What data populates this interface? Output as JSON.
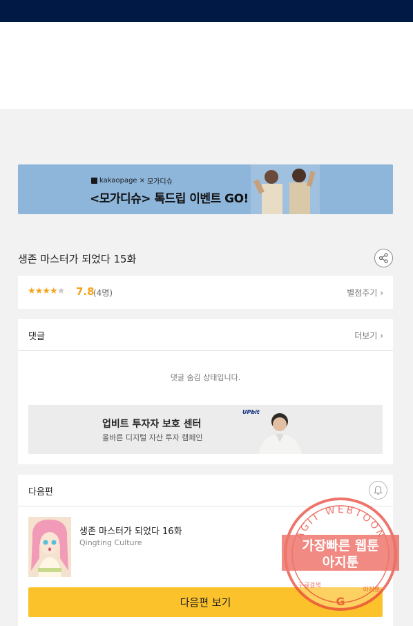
{
  "banner": {
    "brand_kakao": "kakaopage",
    "brand_sep": "×",
    "brand_partner": "모가디슈",
    "headline": "<모가디슈> 톡드립 이벤트 GO!"
  },
  "episode": {
    "title": "생존 마스터가 되었다 15화"
  },
  "rating": {
    "filled_stars": 4,
    "total_stars": 5,
    "score": "7.8",
    "count": "(4명)",
    "rate_link": "별점주기 ›"
  },
  "comments": {
    "label": "댓글",
    "more": "더보기 ›",
    "hidden_message": "댓글 숨김 상태입니다."
  },
  "ad": {
    "logo": "UPbit",
    "title": "업비트 투자자 보호 센터",
    "subtitle": "올바른 디지털 자산 투자 캠페인"
  },
  "next": {
    "label": "다음편",
    "episode_title": "생존 마스터가 되었다 16화",
    "author": "Qingting Culture",
    "button": "다음편 보기"
  },
  "watermark": {
    "arc_text": "AGIT WEBTOON",
    "line1": "가장빠른 웹툰",
    "line2": "아지툰",
    "bottom_left": "구글검색",
    "bottom_right": "아지툰",
    "center_letter": "G"
  },
  "colors": {
    "topbar": "#001a45",
    "accent_yellow": "#fbc22b",
    "star": "#f5a31a",
    "banner_bg": "#8eb5da",
    "stamp": "#e8483c"
  },
  "icons": [
    "share-icon",
    "bell-icon",
    "star-icon",
    "chevron-right-icon"
  ]
}
